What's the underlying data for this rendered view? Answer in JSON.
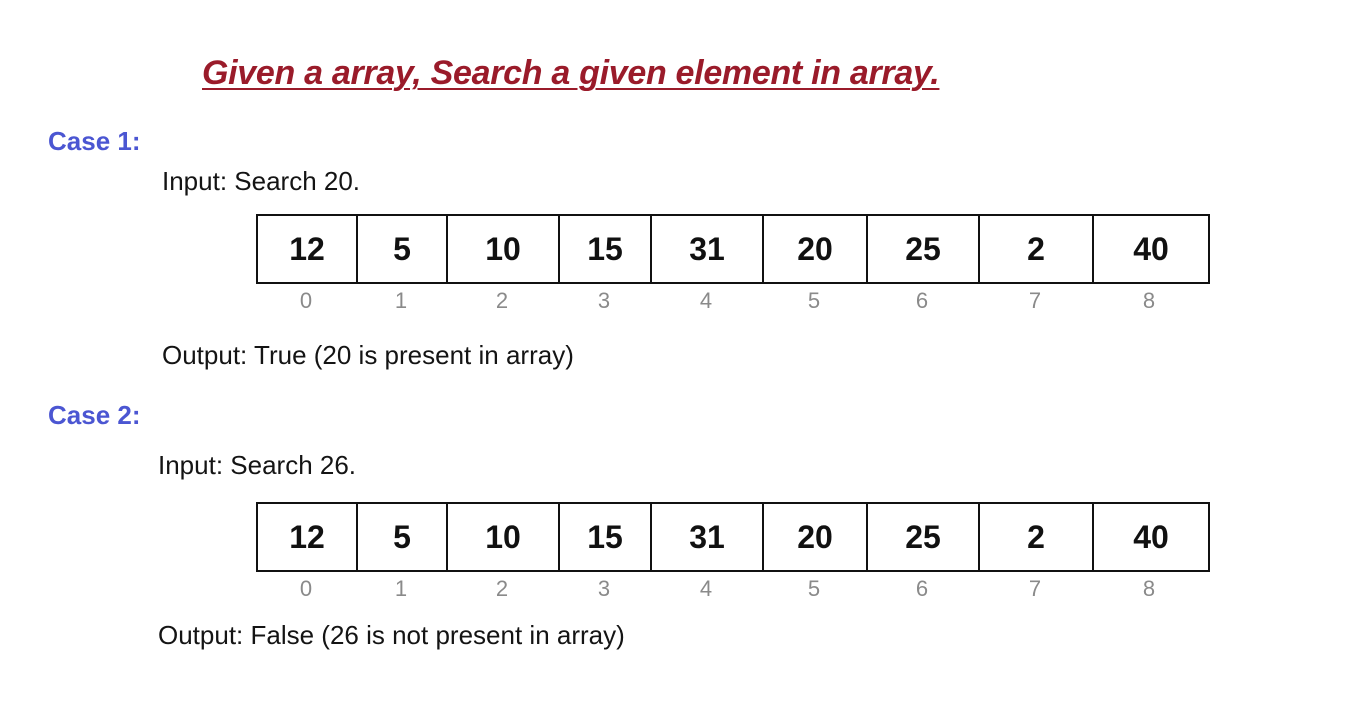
{
  "title": "Given a array, Search a given element in array.",
  "cases": [
    {
      "label": "Case 1:",
      "input": "Input: Search 20.",
      "array": [
        "12",
        "5",
        "10",
        "15",
        "31",
        "20",
        "25",
        "2",
        "40"
      ],
      "indices": [
        "0",
        "1",
        "2",
        "3",
        "4",
        "5",
        "6",
        "7",
        "8"
      ],
      "output": "Output: True (20 is present in array)"
    },
    {
      "label": "Case 2:",
      "input": "Input: Search 26.",
      "array": [
        "12",
        "5",
        "10",
        "15",
        "31",
        "20",
        "25",
        "2",
        "40"
      ],
      "indices": [
        "0",
        "1",
        "2",
        "3",
        "4",
        "5",
        "6",
        "7",
        "8"
      ],
      "output": "Output: False (26 is not present in array)"
    }
  ],
  "colors": {
    "title": "#9a1b2a",
    "case_label": "#4b56d2",
    "index": "#8a8a8a"
  }
}
